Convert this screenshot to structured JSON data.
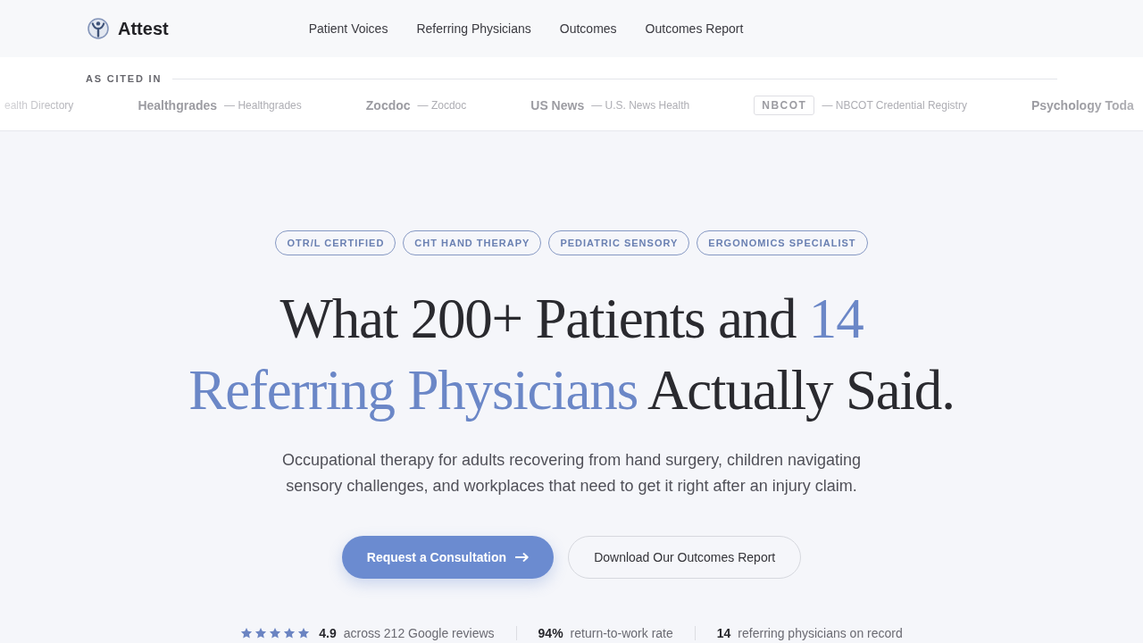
{
  "header": {
    "brand": "Attest",
    "nav": [
      {
        "label": "Patient Voices"
      },
      {
        "label": "Referring Physicians"
      },
      {
        "label": "Outcomes"
      },
      {
        "label": "Outcomes Report"
      }
    ]
  },
  "cited": {
    "label": "AS CITED IN",
    "items": [
      {
        "kind": "text",
        "source": "ealth Directory"
      },
      {
        "kind": "text",
        "name": "Healthgrades",
        "source": "— Healthgrades"
      },
      {
        "kind": "text",
        "name": "Zocdoc",
        "source": "— Zocdoc"
      },
      {
        "kind": "text",
        "name": "US News",
        "source": "— U.S. News Health"
      },
      {
        "kind": "boxed",
        "name": "NBCOT",
        "source": "— NBCOT Credential Registry"
      },
      {
        "kind": "text",
        "name": "Psychology Toda"
      }
    ]
  },
  "hero": {
    "badges": [
      "OTR/L CERTIFIED",
      "CHT HAND THERAPY",
      "PEDIATRIC SENSORY",
      "ERGONOMICS SPECIALIST"
    ],
    "headline": [
      {
        "text": "What 200+ Patients and ",
        "accent": false
      },
      {
        "text": "14 Referring Physicians",
        "accent": true
      },
      {
        "text": " Actually Said.",
        "accent": false
      }
    ],
    "subtitle": "Occupational therapy for adults recovering from hand surgery, children navigating sensory challenges, and workplaces that need to get it right after an injury claim.",
    "buttons": [
      {
        "kind": "primary",
        "label": "Request a Consultation"
      },
      {
        "kind": "secondary",
        "label": "Download Our Outcomes Report"
      }
    ],
    "stats": [
      {
        "kind": "rating",
        "stars": 5,
        "value": "4.9",
        "label": "across 212 Google reviews"
      },
      {
        "kind": "stat",
        "value": "94%",
        "label": "return-to-work rate"
      },
      {
        "kind": "stat",
        "value": "14",
        "label": "referring physicians on record"
      }
    ]
  }
}
